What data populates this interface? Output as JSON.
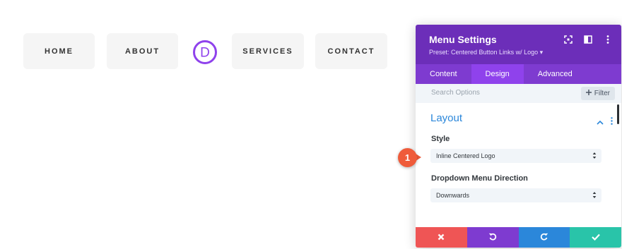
{
  "menu": {
    "items": [
      "HOME",
      "ABOUT",
      "SERVICES",
      "CONTACT"
    ],
    "logo_letter": "D",
    "logo_color": "#8f42ec"
  },
  "panel": {
    "title": "Menu Settings",
    "preset": "Preset: Centered Button Links w/ Logo ▾",
    "header_icons": [
      "fullscreen-icon",
      "split-view-icon",
      "more-options-icon"
    ],
    "tabs": [
      {
        "label": "Content",
        "active": false
      },
      {
        "label": "Design",
        "active": true
      },
      {
        "label": "Advanced",
        "active": false
      }
    ],
    "search": {
      "placeholder": "Search Options",
      "filter_label": "Filter"
    },
    "section": {
      "title": "Layout",
      "fields": [
        {
          "label": "Style",
          "value": "Inline Centered Logo"
        },
        {
          "label": "Dropdown Menu Direction",
          "value": "Downwards"
        }
      ]
    },
    "footer": [
      "cancel-icon",
      "undo-icon",
      "redo-icon",
      "save-check-icon"
    ]
  },
  "callout": {
    "number": "1"
  },
  "colors": {
    "header": "#6c2eb9",
    "tabs": "#7e3bd0",
    "active_tab": "#8f42ec",
    "section_title": "#2b87da",
    "cancel": "#ef5555",
    "undo": "#7e3bd0",
    "redo": "#2b87da",
    "save": "#29c4a9",
    "callout": "#ef5b3a"
  }
}
